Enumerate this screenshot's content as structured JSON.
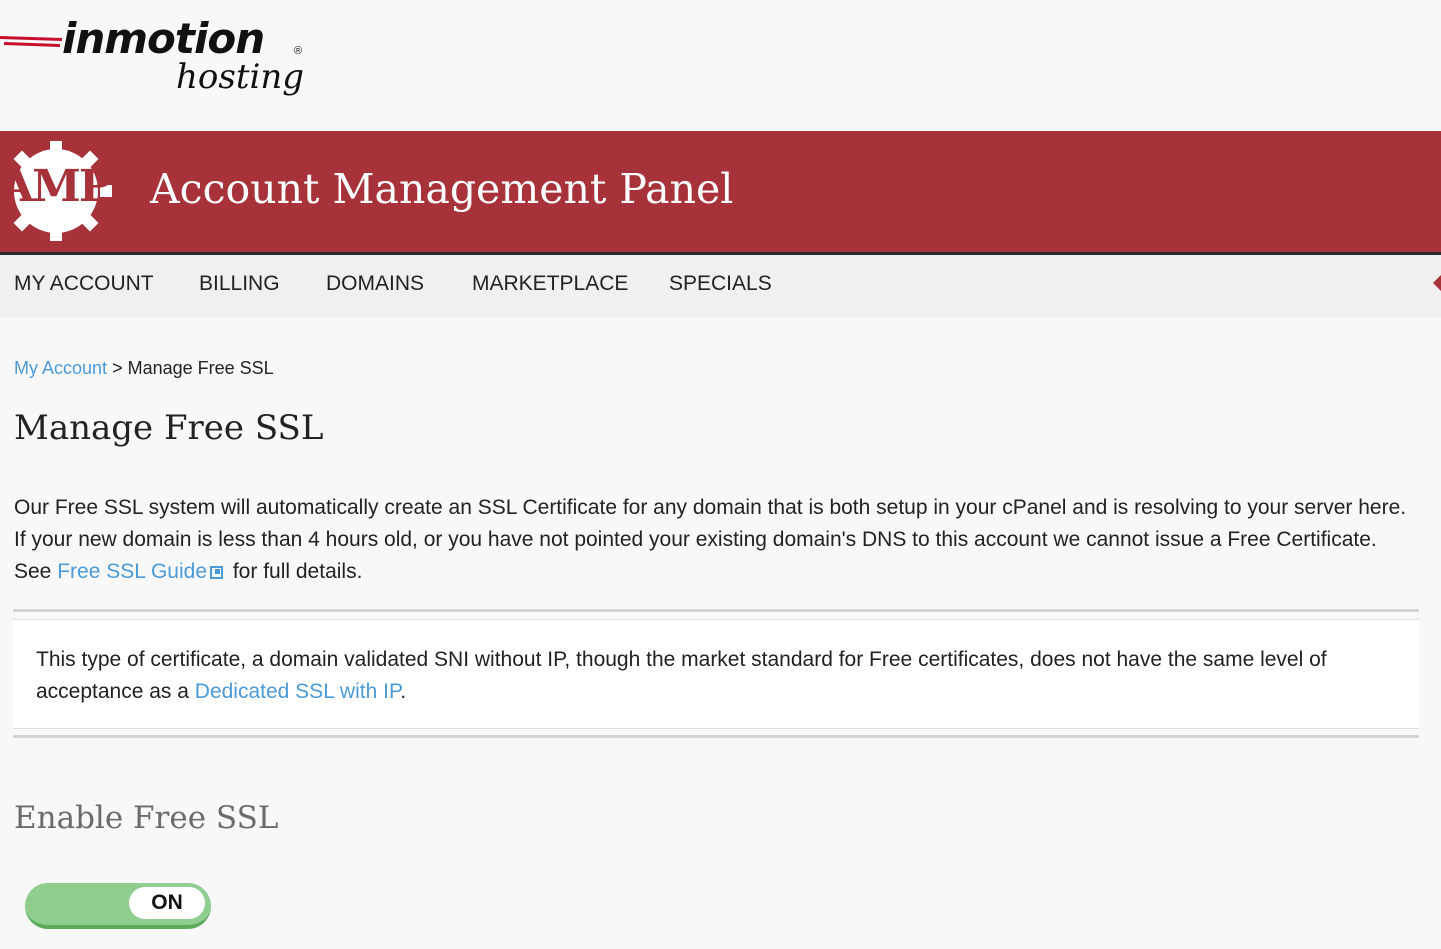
{
  "brand": {
    "logo_word": "inmotion",
    "logo_registered": "®",
    "logo_sub": "hosting"
  },
  "banner": {
    "badge_text": "AMP",
    "title": "Account Management Panel",
    "background_color": "#a8323a"
  },
  "nav": {
    "items": [
      {
        "label": "MY ACCOUNT"
      },
      {
        "label": "BILLING"
      },
      {
        "label": "DOMAINS"
      },
      {
        "label": "MARKETPLACE"
      },
      {
        "label": "SPECIALS"
      }
    ]
  },
  "breadcrumb": {
    "link": "My Account",
    "separator": ">",
    "current": "Manage Free SSL"
  },
  "page": {
    "title": "Manage Free SSL",
    "intro_before": "Our Free SSL system will automatically create an SSL Certificate for any domain that is both setup in your cPanel and is resolving to your server here. If your new domain is less than 4 hours old, or you have not pointed your existing domain's DNS to this account we cannot issue a Free Certificate. See ",
    "intro_link": "Free SSL Guide",
    "intro_after": " for full details.",
    "link_color": "#4b9ad8"
  },
  "notice": {
    "text_before": "This type of certificate, a domain validated SNI without IP, though the market standard for Free certificates, does not have the same level of acceptance as a ",
    "link": "Dedicated SSL with IP",
    "text_after": "."
  },
  "enable_section": {
    "title": "Enable Free SSL",
    "toggle_label": "ON",
    "toggle_state": "on",
    "toggle_color": "#8fce8f"
  }
}
